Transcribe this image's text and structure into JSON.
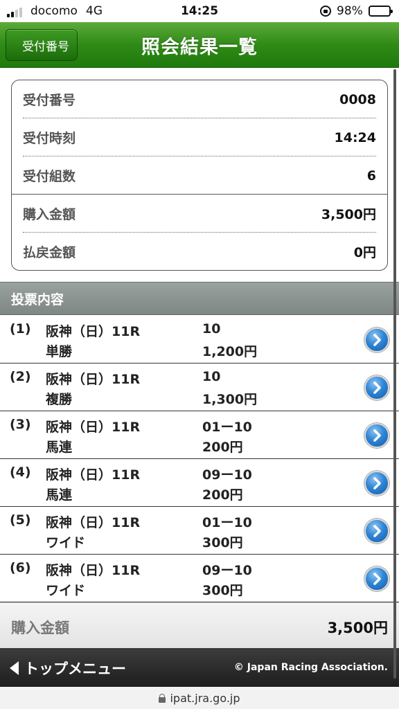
{
  "status_bar": {
    "carrier": "docomo",
    "network": "4G",
    "time": "14:25",
    "battery": "98%"
  },
  "header": {
    "back_label": "受付番号",
    "title": "照会結果一覧"
  },
  "summary": {
    "rows": [
      {
        "label": "受付番号",
        "value": "0008"
      },
      {
        "label": "受付時刻",
        "value": "14:24"
      },
      {
        "label": "受付組数",
        "value": "6"
      },
      {
        "label": "購入金額",
        "value": "3,500円"
      },
      {
        "label": "払戻金額",
        "value": "0円"
      }
    ]
  },
  "section": {
    "title": "投票内容"
  },
  "bets": [
    {
      "num": "(1)",
      "venue": "阪神（日）11R",
      "type": "単勝",
      "horse": "10",
      "amount": "1,200円"
    },
    {
      "num": "(2)",
      "venue": "阪神（日）11R",
      "type": "複勝",
      "horse": "10",
      "amount": "1,300円"
    },
    {
      "num": "(3)",
      "venue": "阪神（日）11R",
      "type": "馬連",
      "horse": "01ー10",
      "amount": "200円"
    },
    {
      "num": "(4)",
      "venue": "阪神（日）11R",
      "type": "馬連",
      "horse": "09ー10",
      "amount": "200円"
    },
    {
      "num": "(5)",
      "venue": "阪神（日）11R",
      "type": "ワイド",
      "horse": "01ー10",
      "amount": "300円"
    },
    {
      "num": "(6)",
      "venue": "阪神（日）11R",
      "type": "ワイド",
      "horse": "09ー10",
      "amount": "300円"
    }
  ],
  "total": {
    "label": "購入金額",
    "value": "3,500円"
  },
  "footer": {
    "menu_label": "トップメニュー",
    "copyright": "© Japan Racing Association."
  },
  "urlbar": {
    "url": "ipat.jra.go.jp"
  },
  "colors": {
    "header_green": "#2f8a16",
    "section_gray": "#8a928f",
    "footer_dark": "#2a2a2a",
    "detail_blue": "#2f86d6"
  }
}
